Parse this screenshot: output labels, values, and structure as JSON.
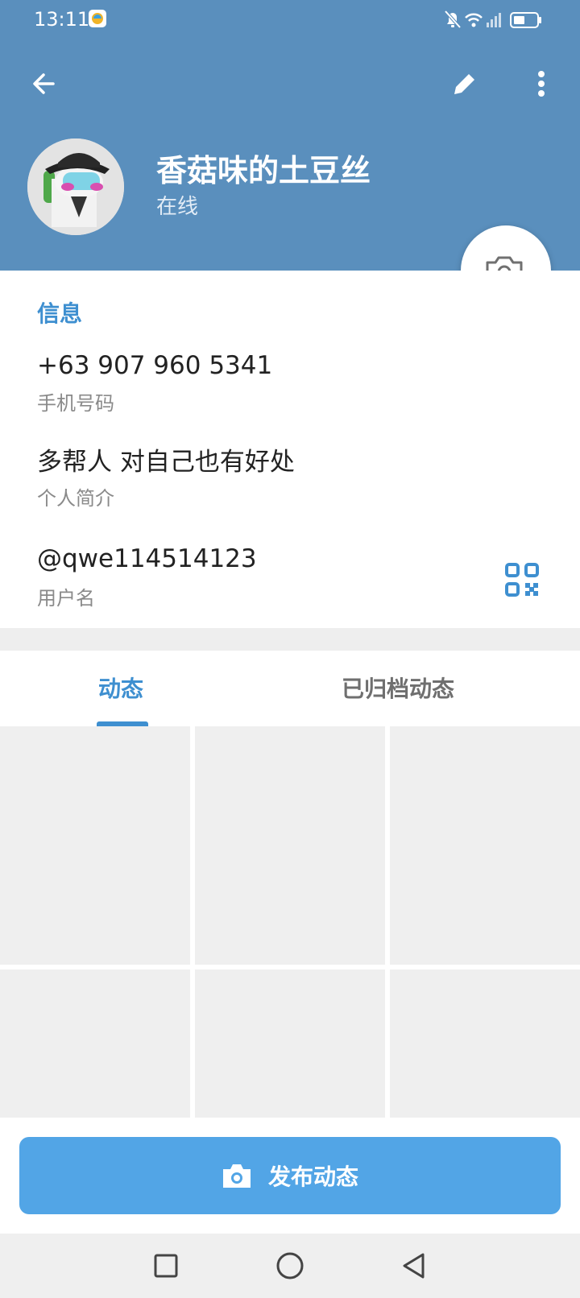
{
  "status_bar": {
    "time": "13:11"
  },
  "profile": {
    "name": "香菇味的土豆丝",
    "presence": "在线"
  },
  "info": {
    "title": "信息",
    "phone": {
      "value": "+63 907 960 5341",
      "label": "手机号码"
    },
    "bio": {
      "value": "多帮人 对自己也有好处",
      "label": "个人简介"
    },
    "username": {
      "value": "@qwe114514123",
      "label": "用户名"
    }
  },
  "tabs": [
    {
      "label": "动态",
      "active": true
    },
    {
      "label": "已归档动态",
      "active": false
    }
  ],
  "publish_button": {
    "label": "发布动态"
  },
  "colors": {
    "header": "#5a8fbd",
    "accent": "#3e8fd0",
    "button": "#52a5e6"
  },
  "icons": [
    "back-arrow-icon",
    "edit-pencil-icon",
    "more-vert-icon",
    "add-photo-icon",
    "qr-code-icon",
    "camera-icon",
    "nav-square-icon",
    "nav-circle-icon",
    "nav-back-icon",
    "mute-icon",
    "wifi-icon",
    "signal-icon",
    "battery-icon"
  ]
}
